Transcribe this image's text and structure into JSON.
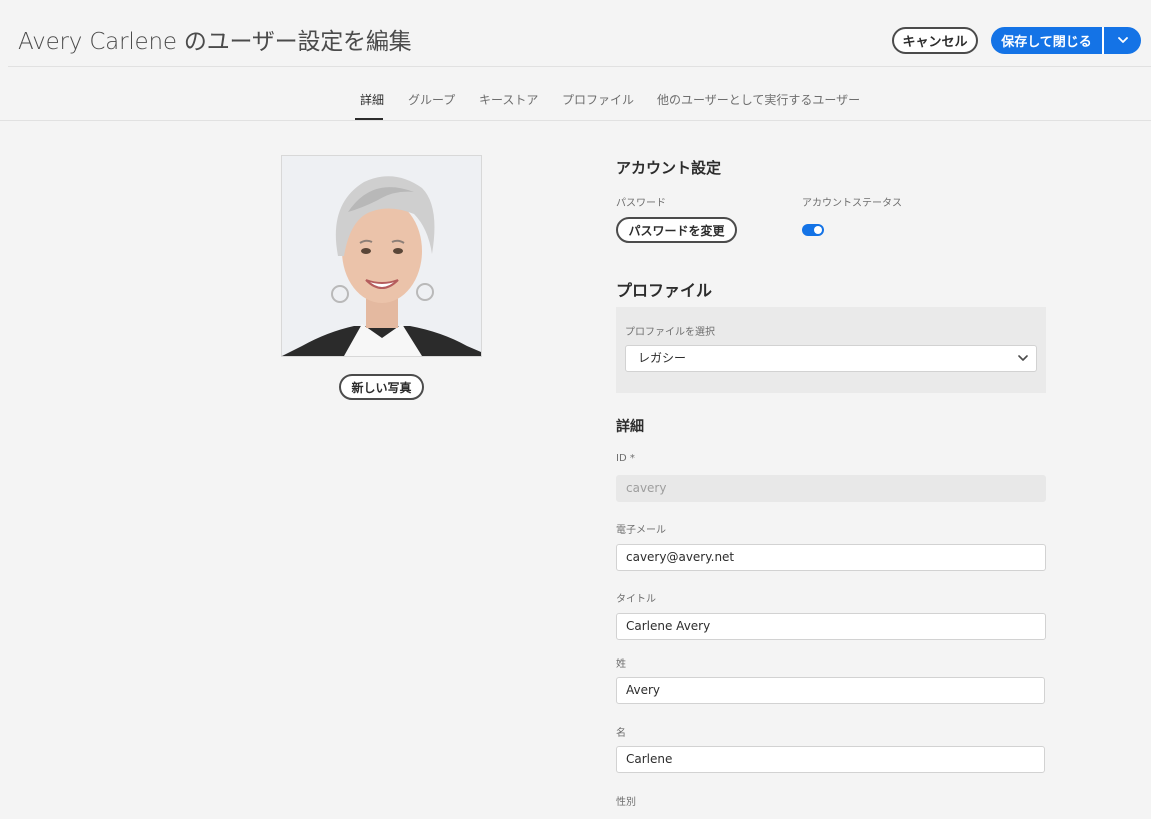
{
  "header": {
    "title": "Avery Carlene のユーザー設定を編集",
    "cancel_label": "キャンセル",
    "save_label": "保存して閉じる"
  },
  "tabs": [
    {
      "label": "詳細",
      "active": true
    },
    {
      "label": "グループ",
      "active": false
    },
    {
      "label": "キーストア",
      "active": false
    },
    {
      "label": "プロファイル",
      "active": false
    },
    {
      "label": "他のユーザーとして実行するユーザー",
      "active": false
    }
  ],
  "photo": {
    "new_photo_label": "新しい写真"
  },
  "account": {
    "heading": "アカウント設定",
    "password_label": "パスワード",
    "change_password_label": "パスワードを変更",
    "status_label": "アカウントステータス",
    "status_enabled": true
  },
  "profile": {
    "heading": "プロファイル",
    "select_label": "プロファイルを選択",
    "selected_value": "レガシー"
  },
  "details": {
    "heading": "詳細",
    "id_label": "ID *",
    "id_value": "cavery",
    "email_label": "電子メール",
    "email_value": "cavery@avery.net",
    "title_label": "タイトル",
    "title_value": "Carlene Avery",
    "last_name_label": "姓",
    "last_name_value": "Avery",
    "first_name_label": "名",
    "first_name_value": "Carlene",
    "gender_label": "性別"
  },
  "colors": {
    "accent": "#1473e6",
    "background": "#f4f4f4"
  }
}
